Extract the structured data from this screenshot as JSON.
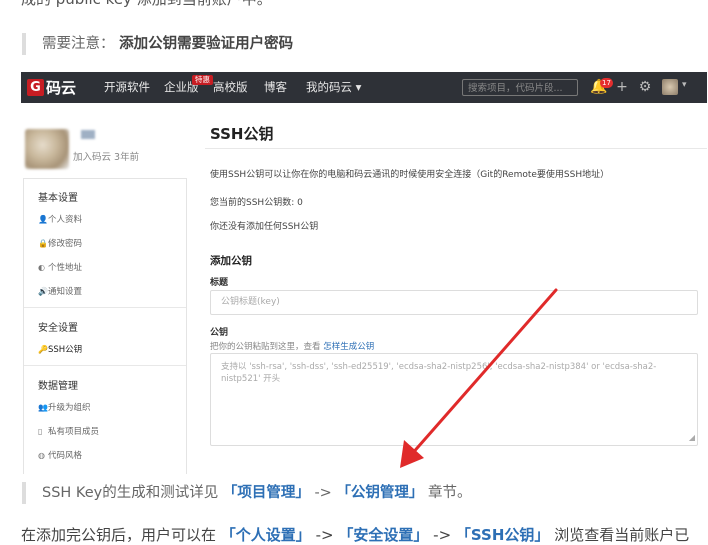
{
  "doc": {
    "top_text": "成的 public key 添加到当前账户中。",
    "note_prefix": "需要注意：",
    "note_bold": "添加公钥需要验证用户密码",
    "ref_prefix": "SSH Key的生成和测试详见",
    "ref_link1": "「项目管理」",
    "ref_sep": "->",
    "ref_link2": "「公钥管理」",
    "ref_suffix": "章节。",
    "bottom_prefix": "在添加完公钥后，用户可以在",
    "bottom_l1": "「个人设置」",
    "bottom_sep1": "->",
    "bottom_l2": "「安全设置」",
    "bottom_sep2": "->",
    "bottom_l3": "「SSH公钥」",
    "bottom_suffix": "浏览查看当前账户已"
  },
  "nav": {
    "logo_letter": "G",
    "logo_text": "码云",
    "items": [
      "开源软件",
      "企业版",
      "高校版",
      "博客",
      "我的码云 ▾"
    ],
    "enterprise_badge": "特惠",
    "search_placeholder": "搜索项目，代码片段...",
    "notif_count": "17",
    "icons": [
      "bell-icon",
      "plus-icon",
      "gear-icon",
      "avatar",
      "caret-down-icon"
    ]
  },
  "sidebar": {
    "joined": "加入码云 3年前",
    "sections": [
      {
        "title": "基本设置",
        "items": [
          {
            "icon": "👤",
            "label": "个人资料"
          },
          {
            "icon": "🔒",
            "label": "修改密码"
          },
          {
            "icon": "◐",
            "label": "个性地址"
          },
          {
            "icon": "🔊",
            "label": "通知设置"
          }
        ]
      },
      {
        "title": "安全设置",
        "items": [
          {
            "icon": "🔑",
            "label": "SSH公钥"
          }
        ]
      },
      {
        "title": "数据管理",
        "items": [
          {
            "icon": "👥",
            "label": "升级为组织"
          },
          {
            "icon": "▯",
            "label": "私有项目成员"
          },
          {
            "icon": "◍",
            "label": "代码风格"
          }
        ]
      }
    ]
  },
  "main": {
    "title": "SSH公钥",
    "desc": "使用SSH公钥可以让你在你的电脑和码云通讯的时候使用安全连接（Git的Remote要使用SSH地址）",
    "count_text": "您当前的SSH公钥数: 0",
    "empty_text": "你还没有添加任何SSH公钥",
    "add_heading": "添加公钥",
    "title_label": "标题",
    "title_placeholder": "公钥标题(key)",
    "key_label": "公钥",
    "key_hint": "把你的公钥粘贴到这里，查看",
    "key_hint_link": "怎样生成公钥",
    "key_placeholder": "支持以 'ssh-rsa', 'ssh-dss', 'ssh-ed25519', 'ecdsa-sha2-nistp256', 'ecdsa-sha2-nistp384' or 'ecdsa-sha2-nistp521' 开头"
  },
  "colors": {
    "nav_bg": "#2e3137",
    "brand_red": "#c71d23",
    "link_blue": "#2d6fb5",
    "arrow_red": "#e02a2a"
  }
}
